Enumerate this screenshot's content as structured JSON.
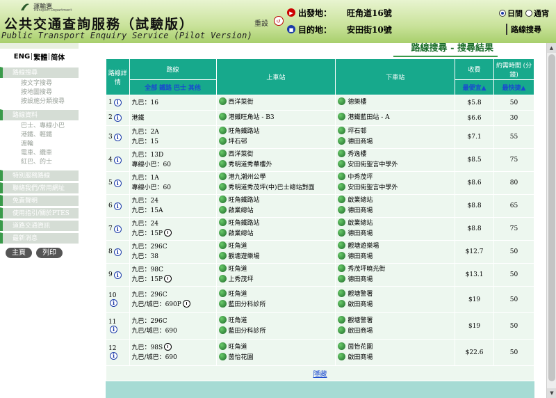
{
  "header": {
    "logo_text": "運輸署",
    "logo_subtext": "Transport Department",
    "title_zh": "公共交通查詢服務（試驗版）",
    "title_en": "Public Transport Enquiry Service (Pilot Version)",
    "reset_label": "重設",
    "origin_label": "出發地：",
    "origin_value": "旺角道16號",
    "destination_label": "目的地：",
    "destination_value": "安田街10號",
    "day_label": "日間",
    "night_label": "通宵",
    "route_search_tab": "路線搜尋"
  },
  "sidebar": {
    "lang_eng": "ENG",
    "lang_trad": "繁體",
    "lang_simp": "简体",
    "sections": [
      {
        "label": "路線搜尋",
        "items": [
          "按文字搜尋",
          "按地圖搜尋",
          "按設施分類搜尋"
        ]
      },
      {
        "label": "路線資料",
        "items": [
          "巴士、專線小巴",
          "港鐵、輕鐵",
          "渡輪",
          "電車、纜車",
          "紅巴、的士"
        ]
      },
      {
        "label": "特別服務路線",
        "items": []
      },
      {
        "label": "聯絡我們/常用網址",
        "items": []
      },
      {
        "label": "免責聲明",
        "items": []
      },
      {
        "label": "使用指引/關於PTES",
        "items": []
      },
      {
        "label": "道路交通資訊",
        "items": []
      },
      {
        "label": "最新消息",
        "items": []
      }
    ],
    "home_button": "主頁",
    "print_button": "列印"
  },
  "main": {
    "heading": "路線搜尋 - 搜尋結果",
    "columns": {
      "details": "路線詳情",
      "route": "路線",
      "boarding": "上車站",
      "alighting": "下車站",
      "fee": "收費",
      "time": "約需時間 (分鐘)"
    },
    "filter_all": "全部",
    "filter_rail": "鐵路",
    "filter_bus": "巴士",
    "filter_other": "其他",
    "sort_cheapest": "最便宜",
    "sort_fastest": "最快捷",
    "rows": [
      {
        "num": "1",
        "routes": [
          "九巴：16"
        ],
        "clocks": [
          false
        ],
        "boarding": [
          "西洋菜街"
        ],
        "alighting": [
          "德樂樓"
        ],
        "fee": "$5.8",
        "time": "50"
      },
      {
        "num": "2",
        "routes": [
          "港鐵"
        ],
        "clocks": [
          false
        ],
        "boarding": [
          "港鐵旺角站 - B3"
        ],
        "alighting": [
          "港鐵藍田站 - A"
        ],
        "fee": "$6.6",
        "time": "30"
      },
      {
        "num": "3",
        "routes": [
          "九巴：2A",
          "九巴：15"
        ],
        "clocks": [
          false,
          false
        ],
        "boarding": [
          "旺角鐵路站",
          "坪石邨"
        ],
        "alighting": [
          "坪石邨",
          "德田商場"
        ],
        "fee": "$7.1",
        "time": "55"
      },
      {
        "num": "4",
        "routes": [
          "九巴：13D",
          "專線小巴：60"
        ],
        "clocks": [
          false,
          false
        ],
        "boarding": [
          "西洋菜街",
          "秀明道秀華樓外"
        ],
        "alighting": [
          "秀逸樓",
          "安田街聖言中學外"
        ],
        "fee": "$8.5",
        "time": "75"
      },
      {
        "num": "5",
        "routes": [
          "九巴：1A",
          "專線小巴：60"
        ],
        "clocks": [
          false,
          false
        ],
        "boarding": [
          "港九潮州公學",
          "秀明道秀茂坪(中)巴士總站對面"
        ],
        "alighting": [
          "中秀茂坪",
          "安田街聖言中學外"
        ],
        "fee": "$8.6",
        "time": "80"
      },
      {
        "num": "6",
        "routes": [
          "九巴：24",
          "九巴：15A"
        ],
        "clocks": [
          false,
          false
        ],
        "boarding": [
          "旺角鐵路站",
          "啟業總站"
        ],
        "alighting": [
          "啟業總站",
          "德田商場"
        ],
        "fee": "$8.8",
        "time": "65"
      },
      {
        "num": "7",
        "routes": [
          "九巴：24",
          "九巴：15P"
        ],
        "clocks": [
          false,
          true
        ],
        "boarding": [
          "旺角鐵路站",
          "啟業總站"
        ],
        "alighting": [
          "啟業總站",
          "德田商場"
        ],
        "fee": "$8.8",
        "time": "75"
      },
      {
        "num": "8",
        "routes": [
          "九巴：296C",
          "九巴：38"
        ],
        "clocks": [
          false,
          false
        ],
        "boarding": [
          "旺角道",
          "觀塘遊樂場"
        ],
        "alighting": [
          "觀塘遊樂場",
          "德田商場"
        ],
        "fee": "$12.7",
        "time": "50"
      },
      {
        "num": "9",
        "routes": [
          "九巴：98C",
          "九巴：15P"
        ],
        "clocks": [
          false,
          true
        ],
        "boarding": [
          "旺角道",
          "上秀茂坪"
        ],
        "alighting": [
          "秀茂坪曉光街",
          "德田商場"
        ],
        "fee": "$13.1",
        "time": "50"
      },
      {
        "num": "10",
        "routes": [
          "九巴：296C",
          "九巴/城巴：690P"
        ],
        "clocks": [
          false,
          true
        ],
        "boarding": [
          "旺角道",
          "藍田分科診所"
        ],
        "alighting": [
          "觀塘警署",
          "啟田商場"
        ],
        "fee": "$19",
        "time": "50"
      },
      {
        "num": "11",
        "routes": [
          "九巴：296C",
          "九巴/城巴：690"
        ],
        "clocks": [
          false,
          false
        ],
        "boarding": [
          "旺角道",
          "藍田分科診所"
        ],
        "alighting": [
          "觀塘警署",
          "啟田商場"
        ],
        "fee": "$19",
        "time": "50"
      },
      {
        "num": "12",
        "routes": [
          "九巴：98S",
          "九巴/城巴：690"
        ],
        "clocks": [
          true,
          false
        ],
        "boarding": [
          "旺角道",
          "茵怡花園"
        ],
        "alighting": [
          "茵怡花園",
          "啟田商場"
        ],
        "fee": "$22.6",
        "time": "50"
      }
    ],
    "hide_link": "隱藏"
  }
}
